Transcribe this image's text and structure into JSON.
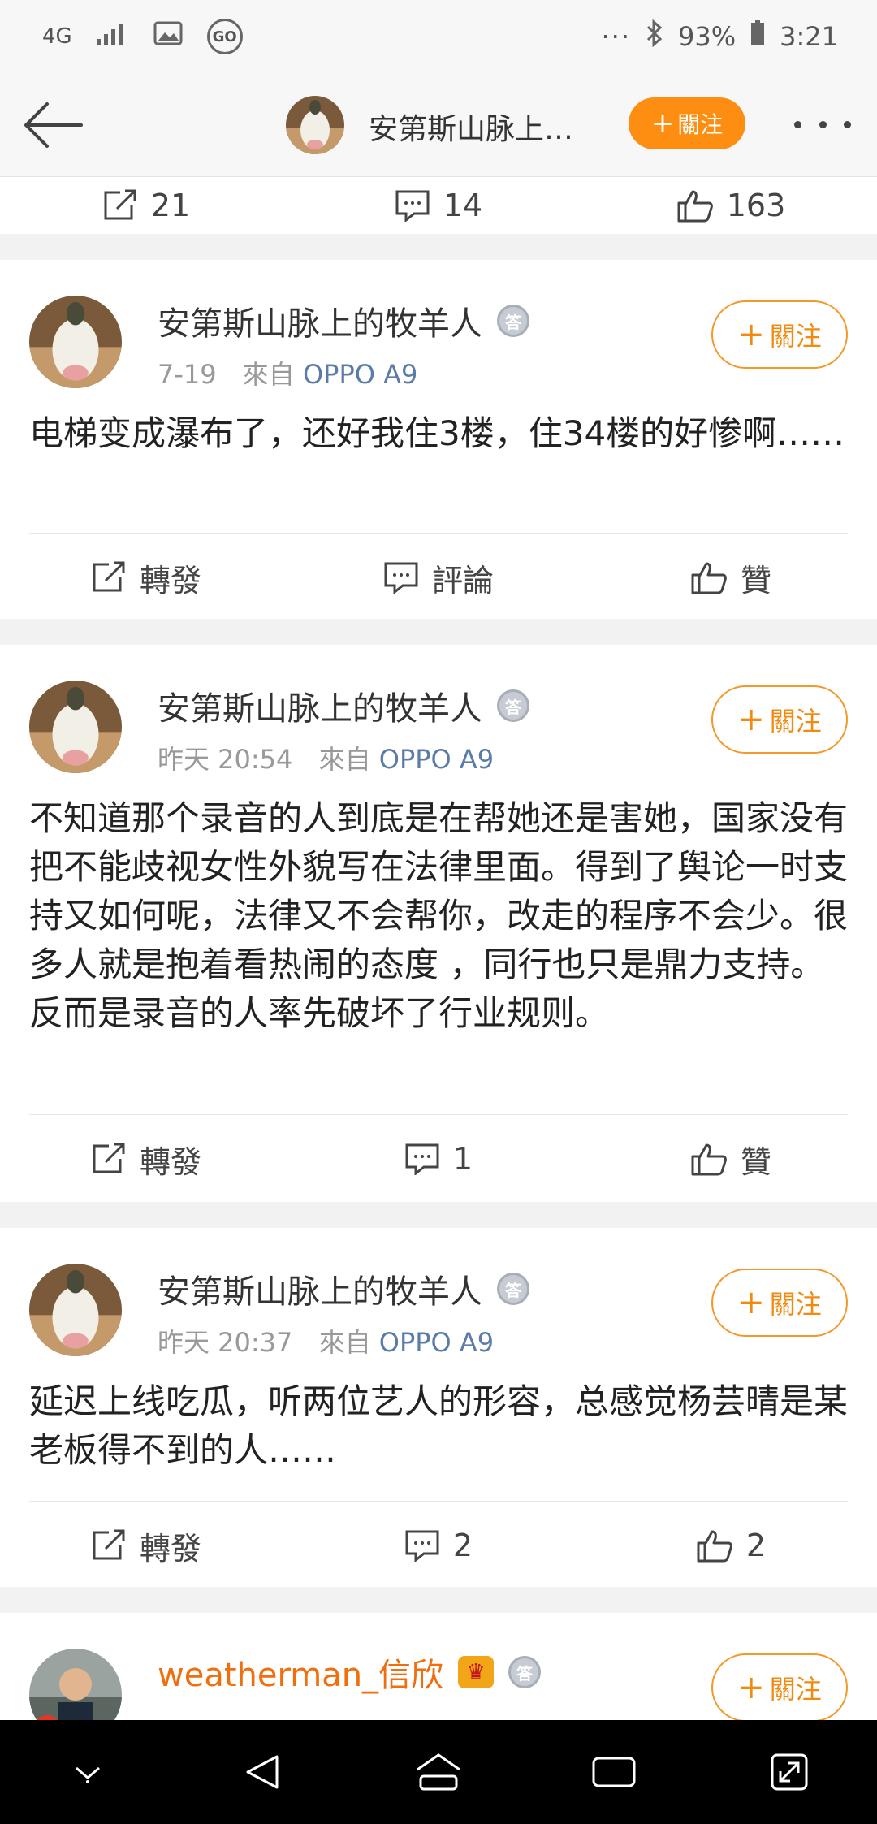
{
  "statusbar": {
    "network": "4G",
    "go_label": "GO",
    "dots": "···",
    "battery": "93%",
    "time": "3:21"
  },
  "topnav": {
    "title": "安第斯山脉上…",
    "follow_label": "關注"
  },
  "partial_card": {
    "repost_count": "21",
    "comment_count": "14",
    "like_count": "163"
  },
  "colors": {
    "accent": "#fd8e11",
    "source_link": "#5b7ba8",
    "username_vip": "#f06e0e"
  },
  "posts": [
    {
      "username": "安第斯山脉上的牧羊人",
      "badge_icon": "answer-medal-icon",
      "badge_text": "答",
      "time": "7-19",
      "from_label": "來自",
      "source": "OPPO A9",
      "follow_label": "關注",
      "text": "电梯变成瀑布了，还好我住3楼，住34楼的好惨啊……",
      "repost_label": "轉發",
      "comment_label": "評論",
      "like_label": "贊"
    },
    {
      "username": "安第斯山脉上的牧羊人",
      "badge_icon": "answer-medal-icon",
      "badge_text": "答",
      "time": "昨天 20:54",
      "from_label": "來自",
      "source": "OPPO A9",
      "follow_label": "關注",
      "text": "不知道那个录音的人到底是在帮她还是害她，国家没有把不能歧视女性外貌写在法律里面。得到了舆论一时支持又如何呢，法律又不会帮你，改走的程序不会少。很多人就是抱着看热闹的态度 ，同行也只是鼎力支持。反而是录音的人率先破坏了行业规则。",
      "repost_label": "轉發",
      "comment_label": "1",
      "like_label": "贊"
    },
    {
      "username": "安第斯山脉上的牧羊人",
      "badge_icon": "answer-medal-icon",
      "badge_text": "答",
      "time": "昨天 20:37",
      "from_label": "來自",
      "source": "OPPO A9",
      "follow_label": "關注",
      "text": "延迟上线吃瓜，听两位艺人的形容，总感觉杨芸晴是某老板得不到的人……",
      "repost_label": "轉發",
      "comment_label": "2",
      "like_label": "2"
    },
    {
      "username": "weatherman_信欣",
      "badge_icon": "answer-medal-icon",
      "badge_text": "答",
      "vip_icon": "crown-icon",
      "follow_label": "關注"
    }
  ]
}
